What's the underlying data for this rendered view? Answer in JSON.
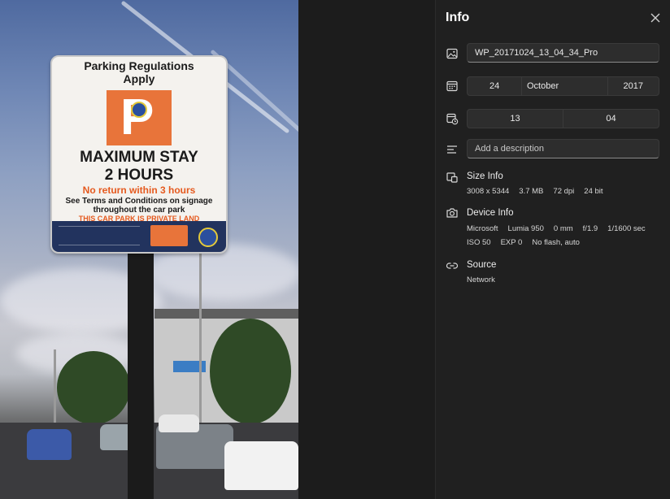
{
  "photo": {
    "sign": {
      "title_line1": "Parking Regulations",
      "title_line2": "Apply",
      "p_letter": "P",
      "max_stay": "MAXIMUM STAY",
      "hours": "2 HOURS",
      "no_return": "No return within 3 hours",
      "terms_line1": "See Terms and Conditions on signage",
      "terms_line2": "throughout the car park",
      "private": "THIS CAR PARK IS PRIVATE LAND"
    }
  },
  "info_panel": {
    "title": "Info",
    "close_icon": "close-icon",
    "file_name": "WP_20171024_13_04_34_Pro",
    "date": {
      "day": "24",
      "month": "October",
      "year": "2017"
    },
    "time": {
      "hour": "13",
      "minute": "04"
    },
    "description_placeholder": "Add a description",
    "size_info": {
      "title": "Size Info",
      "dimensions": "3008 x 5344",
      "file_size": "3.7 MB",
      "dpi": "72 dpi",
      "bit_depth": "24 bit"
    },
    "device_info": {
      "title": "Device Info",
      "maker": "Microsoft",
      "model": "Lumia 950",
      "focal": "0 mm",
      "aperture": "f/1.9",
      "shutter": "1/1600 sec",
      "iso": "ISO 50",
      "exposure": "EXP 0",
      "flash": "No flash, auto"
    },
    "source": {
      "title": "Source",
      "value": "Network"
    },
    "icons": [
      "image-icon",
      "calendar-icon",
      "clock-icon",
      "description-icon",
      "size-icon",
      "camera-icon",
      "link-icon"
    ],
    "colors": {
      "panel_bg": "#202020",
      "field_bg": "#2d2d2d",
      "sign_orange": "#e8743a"
    }
  }
}
